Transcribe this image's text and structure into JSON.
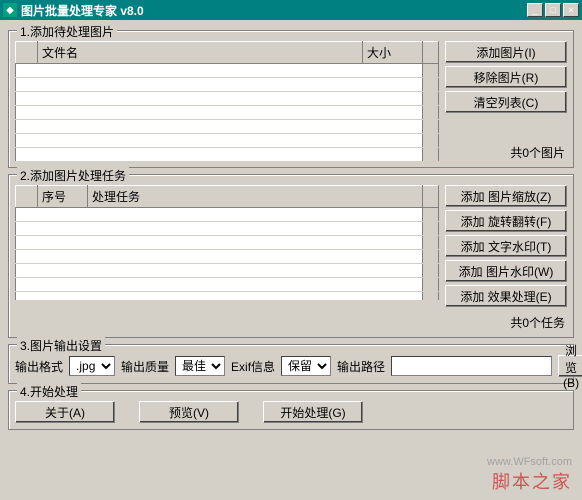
{
  "titlebar": {
    "title": "图片批量处理专家 v8.0",
    "min": "_",
    "max": "□",
    "close": "×"
  },
  "group1": {
    "legend": "1.添加待处理图片",
    "cols": {
      "filename": "文件名",
      "size": "大小"
    },
    "buttons": {
      "add": "添加图片(I)",
      "remove": "移除图片(R)",
      "clear": "清空列表(C)"
    },
    "count": "共0个图片"
  },
  "group2": {
    "legend": "2.添加图片处理任务",
    "cols": {
      "idx": "序号",
      "task": "处理任务"
    },
    "buttons": {
      "zoom": "添加 图片缩放(Z)",
      "rotate": "添加 旋转翻转(F)",
      "textwm": "添加 文字水印(T)",
      "imgwm": "添加 图片水印(W)",
      "effect": "添加 效果处理(E)"
    },
    "count": "共0个任务"
  },
  "group3": {
    "legend": "3.图片输出设置",
    "labels": {
      "format": "输出格式",
      "quality": "输出质量",
      "exif": "Exif信息",
      "path": "输出路径"
    },
    "values": {
      "format": ".jpg",
      "quality": "最佳",
      "exif": "保留",
      "path": ""
    },
    "browse": "浏览(B)"
  },
  "group4": {
    "legend": "4.开始处理",
    "buttons": {
      "about": "关于(A)",
      "preview": "预览(V)",
      "start": "开始处理(G)"
    }
  },
  "watermark": {
    "zh": "脚本之家",
    "url": "www.WFsoft.com"
  }
}
